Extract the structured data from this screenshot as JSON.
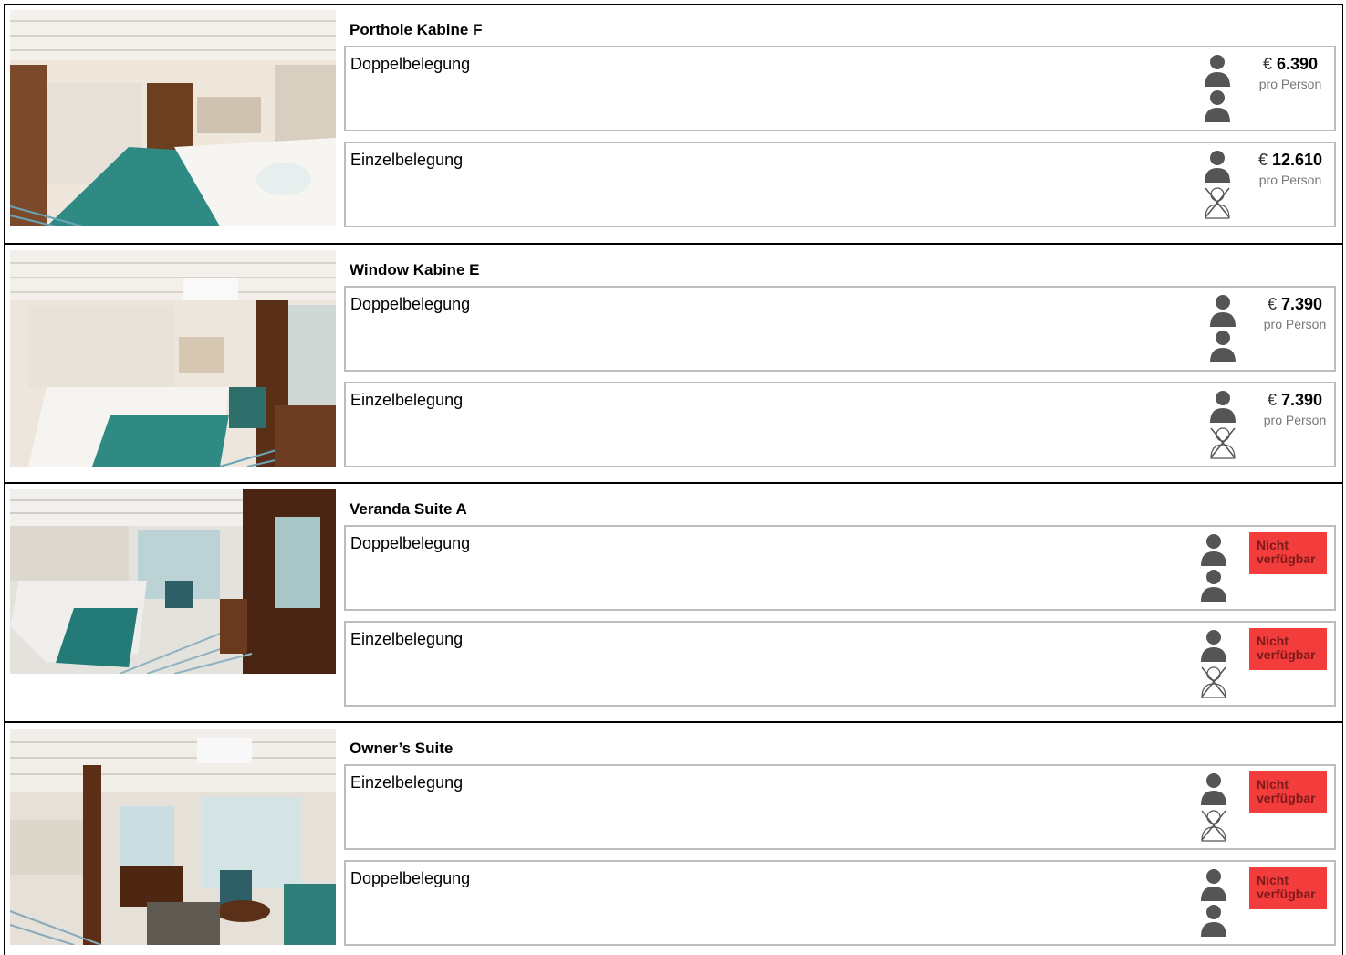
{
  "cabins": [
    {
      "title": "Porthole Kabine F",
      "options": [
        {
          "label": "Doppelbelegung",
          "occupancy": "double",
          "currency": "€",
          "price": "6.390",
          "price_note": "pro Person",
          "available": true
        },
        {
          "label": "Einzelbelegung",
          "occupancy": "single",
          "currency": "€",
          "price": "12.610",
          "price_note": "pro Person",
          "available": true
        }
      ]
    },
    {
      "title": "Window Kabine E",
      "options": [
        {
          "label": "Doppelbelegung",
          "occupancy": "double",
          "currency": "€",
          "price": "7.390",
          "price_note": "pro Person",
          "available": true
        },
        {
          "label": "Einzelbelegung",
          "occupancy": "single",
          "currency": "€",
          "price": "7.390",
          "price_note": "pro Person",
          "available": true
        }
      ]
    },
    {
      "title": "Veranda Suite A",
      "options": [
        {
          "label": "Doppelbelegung",
          "occupancy": "double",
          "unavailable_text": "Nicht verfügbar",
          "available": false
        },
        {
          "label": "Einzelbelegung",
          "occupancy": "single",
          "unavailable_text": "Nicht verfügbar",
          "available": false
        }
      ]
    },
    {
      "title": "Owner’s Suite",
      "options": [
        {
          "label": "Einzelbelegung",
          "occupancy": "single",
          "unavailable_text": "Nicht verfügbar",
          "available": false
        },
        {
          "label": "Doppelbelegung",
          "occupancy": "double",
          "unavailable_text": "Nicht verfügbar",
          "available": false
        }
      ]
    }
  ],
  "icons": {
    "person": "person-icon",
    "no_person": "crossed-person-icon"
  },
  "colors": {
    "unavailable_bg": "#f33d3d",
    "unavailable_text": "#7a1a1a",
    "icon": "#555555",
    "border": "#bdbdbd"
  }
}
